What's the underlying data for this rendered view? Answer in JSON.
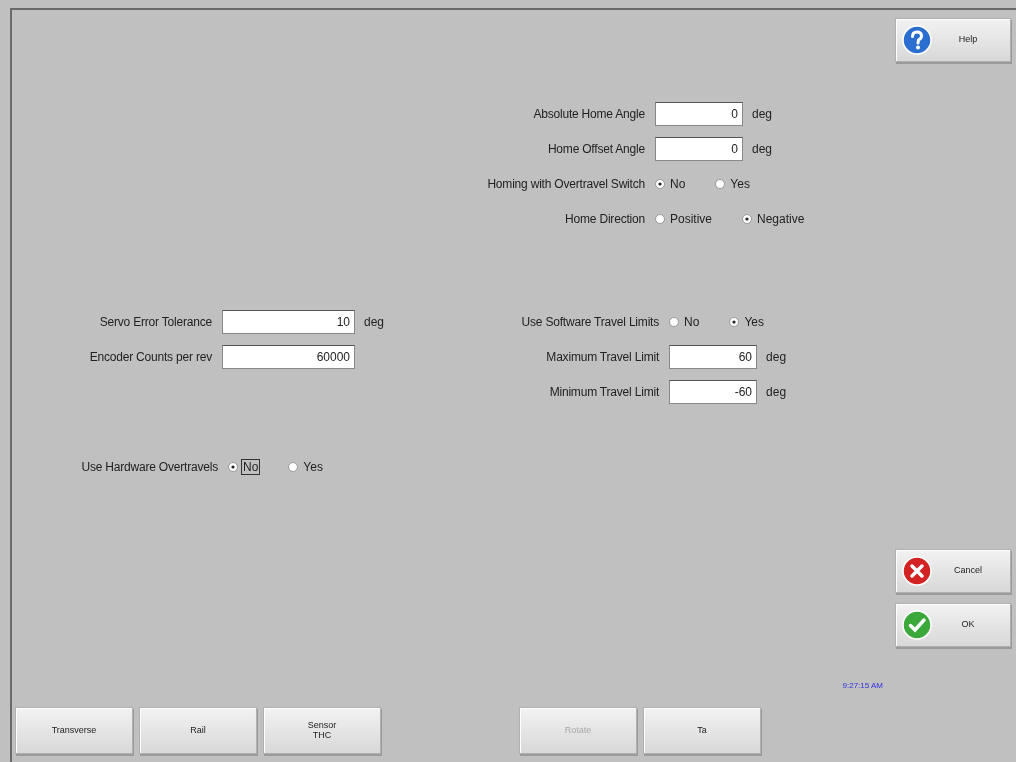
{
  "help_button": {
    "label": "Help"
  },
  "home_settings": [
    {
      "kind": "number",
      "label": "Absolute Home Angle",
      "value": "0",
      "unit": "deg"
    },
    {
      "kind": "number",
      "label": "Home Offset Angle",
      "value": "0",
      "unit": "deg"
    },
    {
      "kind": "radio",
      "label": "Homing with Overtravel Switch",
      "options": [
        {
          "label": "No",
          "selected": true
        },
        {
          "label": "Yes",
          "selected": false
        }
      ]
    },
    {
      "kind": "radio",
      "label": "Home Direction",
      "options": [
        {
          "label": "Positive",
          "selected": false
        },
        {
          "label": "Negative",
          "selected": true
        }
      ]
    }
  ],
  "servo_settings": [
    {
      "kind": "number",
      "label": "Servo Error Tolerance",
      "value": "10",
      "unit": "deg"
    },
    {
      "kind": "number",
      "label": "Encoder Counts per rev",
      "value": "60000"
    }
  ],
  "travel_limits": [
    {
      "kind": "radio",
      "label": "Use Software Travel Limits",
      "options": [
        {
          "label": "No",
          "selected": false
        },
        {
          "label": "Yes",
          "selected": true
        }
      ]
    },
    {
      "kind": "number",
      "label": "Maximum Travel Limit",
      "value": "60",
      "unit": "deg"
    },
    {
      "kind": "number",
      "label": "Minimum Travel Limit",
      "value": "-60",
      "unit": "deg"
    }
  ],
  "hardware_overtravels": {
    "kind": "radio",
    "label": "Use Hardware Overtravels",
    "options": [
      {
        "label": "No",
        "selected": true,
        "focused": true
      },
      {
        "label": "Yes",
        "selected": false,
        "focused": false
      }
    ]
  },
  "cancel_button": {
    "label": "Cancel"
  },
  "ok_button": {
    "label": "OK"
  },
  "clock": "9:27:15 AM",
  "axis_buttons": [
    {
      "label": "Transverse",
      "disabled": false
    },
    {
      "label": "Rail",
      "disabled": false
    },
    {
      "label": "Sensor\nTHC",
      "disabled": false
    }
  ],
  "action_buttons": [
    {
      "label": "Rotate",
      "disabled": true
    },
    {
      "label": "Ta",
      "disabled": false
    }
  ]
}
